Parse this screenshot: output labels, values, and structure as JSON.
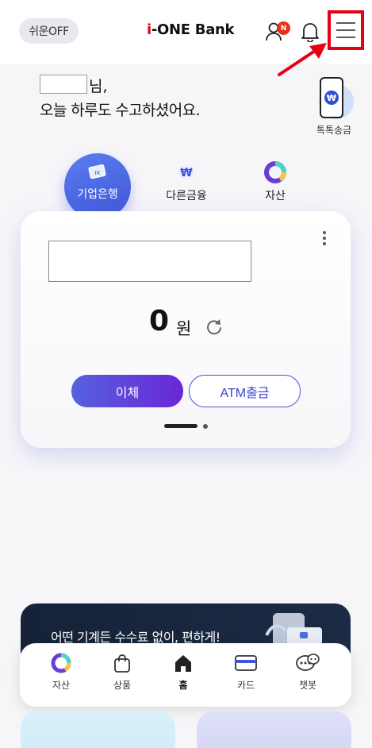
{
  "header": {
    "easy_mode_label": "쉬운OFF",
    "logo_prefix": "i",
    "logo_text": "-ONE Bank",
    "badge_text": "N"
  },
  "greeting": {
    "name_suffix": "님,",
    "message": "오늘 하루도 수고하셨어요."
  },
  "quick_transfer": {
    "label": "톡톡송금",
    "icon_symbol": "₩"
  },
  "account_tabs": [
    {
      "label": "기업은행",
      "active": true
    },
    {
      "label": "다른금융",
      "active": false
    },
    {
      "label": "자산",
      "active": false
    }
  ],
  "account_card": {
    "balance": "0",
    "currency": "원",
    "transfer_label": "이체",
    "atm_label": "ATM출금",
    "page_indicator": {
      "current": 1,
      "total": 2
    }
  },
  "banner": {
    "text": "어떤 기계든 수수료 없이, 편하게!"
  },
  "bottom_nav": [
    {
      "label": "자산",
      "icon": "pie-chart-icon",
      "active": false
    },
    {
      "label": "상품",
      "icon": "shopping-bag-icon",
      "active": false
    },
    {
      "label": "홈",
      "icon": "home-icon",
      "active": true
    },
    {
      "label": "카드",
      "icon": "card-icon",
      "active": false
    },
    {
      "label": "챗봇",
      "icon": "chatbot-icon",
      "active": false
    }
  ],
  "colors": {
    "accent": "#5661e0",
    "highlight": "#e60012",
    "badge": "#e8311a"
  }
}
